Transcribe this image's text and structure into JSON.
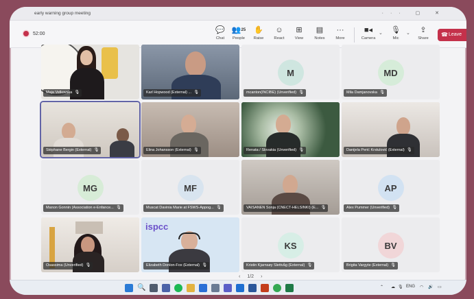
{
  "window": {
    "title": "early warning group meeting"
  },
  "toolbar": {
    "timer": "52:00",
    "people_count": "25",
    "buttons": [
      {
        "label": "Chat",
        "icon": "chat-icon"
      },
      {
        "label": "People",
        "icon": "people-icon"
      },
      {
        "label": "Raise",
        "icon": "raise-hand-icon"
      },
      {
        "label": "React",
        "icon": "react-icon"
      },
      {
        "label": "View",
        "icon": "view-icon"
      },
      {
        "label": "Notes",
        "icon": "notes-icon"
      },
      {
        "label": "More",
        "icon": "more-icon"
      },
      {
        "label": "Camera",
        "icon": "camera-icon"
      },
      {
        "label": "Mic",
        "icon": "mic-icon"
      },
      {
        "label": "Share",
        "icon": "share-icon"
      }
    ],
    "leave_label": "Leave"
  },
  "participants": [
    {
      "name": "Maja Velkovska",
      "initials": "",
      "type": "video",
      "avatar_color": ""
    },
    {
      "name": "Karl Hopwood (External) ...",
      "initials": "",
      "type": "video",
      "avatar_color": ""
    },
    {
      "name": "mcanton(INCIBE) (Unverified)",
      "initials": "M",
      "type": "avatar",
      "avatar_color": "#cfe6e0"
    },
    {
      "name": "Mila Damjanovska",
      "initials": "MD",
      "type": "avatar",
      "avatar_color": "#d6ecd9"
    },
    {
      "name": "Stéphane Bergin (External)",
      "initials": "",
      "type": "video",
      "avatar_color": ""
    },
    {
      "name": "Elina Johansson (External)",
      "initials": "",
      "type": "video",
      "avatar_color": ""
    },
    {
      "name": "Renata / Slovakia (Unverified)",
      "initials": "",
      "type": "video",
      "avatar_color": ""
    },
    {
      "name": "Danijela Perić Krstulović (External)",
      "initials": "",
      "type": "video",
      "avatar_color": ""
    },
    {
      "name": "Manon Gonnin (Association e-Enfance...",
      "initials": "MG",
      "type": "avatar",
      "avatar_color": "#d7ecd7"
    },
    {
      "name": "Muscat Davinia Marie at FSWS-Appog...",
      "initials": "MF",
      "type": "avatar",
      "avatar_color": "#d8e4ef"
    },
    {
      "name": "VAISANEN Sonja (CNECT-HELSINKI) (E...",
      "initials": "",
      "type": "video",
      "avatar_color": ""
    },
    {
      "name": "Alex Pummer (Unverified)",
      "initials": "AP",
      "type": "avatar",
      "avatar_color": "#d2e2f2"
    },
    {
      "name": "Osassima (Unverified)",
      "initials": "",
      "type": "video",
      "avatar_color": ""
    },
    {
      "name": "Elizabeth Donlon-Fox (External)",
      "initials": "",
      "type": "video",
      "avatar_color": ""
    },
    {
      "name": "Kristin Kjarnsøy Slettvåg (External)",
      "initials": "KS",
      "type": "avatar",
      "avatar_color": "#d7eee6"
    },
    {
      "name": "Brigita Vargyte (External)",
      "initials": "BV",
      "type": "avatar",
      "avatar_color": "#f1d6d8"
    }
  ],
  "tile_logo_text": "ispcc",
  "pager": {
    "text": "1/2"
  },
  "taskbar": {
    "language": "ENG"
  }
}
